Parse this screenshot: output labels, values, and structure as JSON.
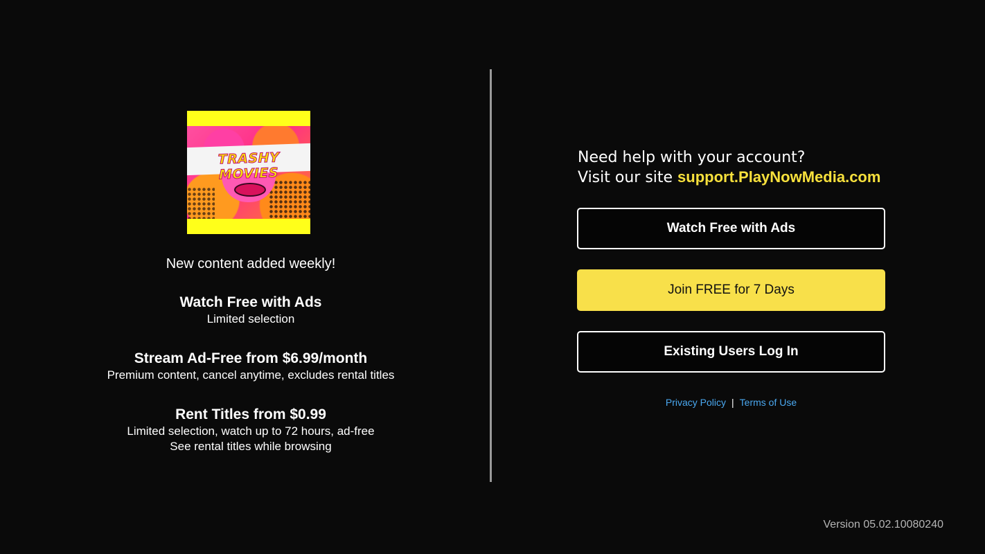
{
  "logo": {
    "text": "TRASHY MOVIES",
    "icon": "trashy-movies-logo"
  },
  "left": {
    "tagline": "New content added weekly!",
    "features": [
      {
        "title": "Watch Free with Ads",
        "desc_lines": [
          "Limited selection"
        ]
      },
      {
        "title": "Stream Ad-Free from $6.99/month",
        "desc_lines": [
          "Premium content, cancel anytime, excludes rental titles"
        ]
      },
      {
        "title": "Rent Titles from $0.99",
        "desc_lines": [
          "Limited selection, watch up to 72 hours, ad-free",
          "See rental titles while browsing"
        ]
      }
    ]
  },
  "right": {
    "help_line1": "Need help with your account?",
    "help_line2_prefix": "Visit our site ",
    "help_link": "support.PlayNowMedia.com",
    "buttons": {
      "watch_free": "Watch Free with Ads",
      "join_free": "Join FREE for 7 Days",
      "log_in": "Existing Users Log In"
    },
    "legal": {
      "privacy": "Privacy Policy",
      "separator": "|",
      "terms": "Terms of Use"
    }
  },
  "version": "Version 05.02.10080240",
  "colors": {
    "background": "#0a0a0a",
    "accent_yellow": "#f8e04a",
    "link_blue": "#4aa8f0",
    "divider": "#9a9a9a"
  }
}
